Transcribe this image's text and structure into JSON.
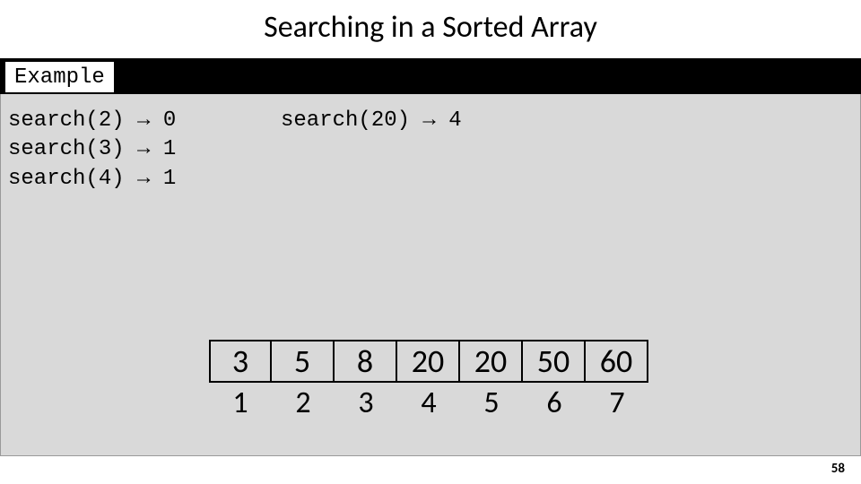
{
  "title": "Searching in a Sorted Array",
  "example_label": "Example",
  "left_calls": "search(2) → 0\nsearch(3) → 1\nsearch(4) → 1",
  "right_calls": "search(20) → 4",
  "array": {
    "values": [
      "3",
      "5",
      "8",
      "20",
      "20",
      "50",
      "60"
    ],
    "indices": [
      "1",
      "2",
      "3",
      "4",
      "5",
      "6",
      "7"
    ]
  },
  "page_number": "58"
}
